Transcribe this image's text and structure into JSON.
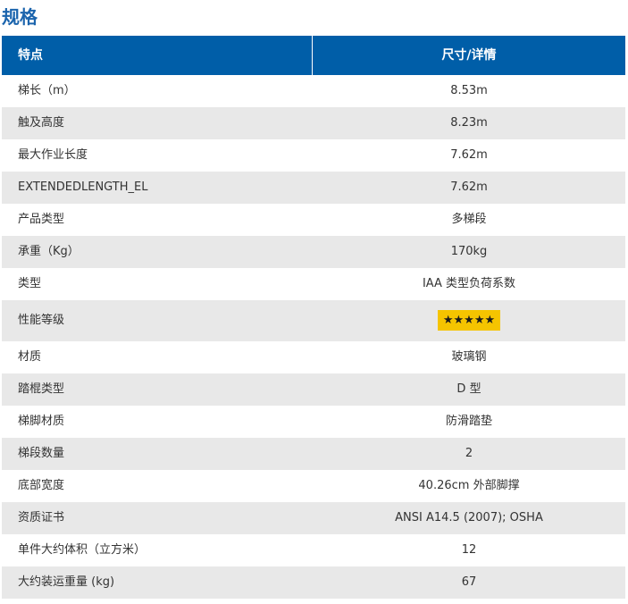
{
  "page": {
    "title": "规格"
  },
  "table": {
    "header": {
      "feature": "特点",
      "detail": "尺寸/详情"
    },
    "rows": [
      {
        "feature": "梯长（m）",
        "value": "8.53m"
      },
      {
        "feature": "触及高度",
        "value": "8.23m"
      },
      {
        "feature": "最大作业长度",
        "value": "7.62m"
      },
      {
        "feature": "EXTENDEDLENGTH_EL",
        "value": "7.62m"
      },
      {
        "feature": "产品类型",
        "value": "多梯段"
      },
      {
        "feature": "承重（Kg）",
        "value": "170kg"
      },
      {
        "feature": "类型",
        "value": "IAA 类型负荷系数"
      },
      {
        "feature": "性能等级",
        "value": "★★★★★",
        "rating": 5
      },
      {
        "feature": "材质",
        "value": "玻璃钢"
      },
      {
        "feature": "踏棍类型",
        "value": "D 型"
      },
      {
        "feature": "梯脚材质",
        "value": "防滑踏垫"
      },
      {
        "feature": "梯段数量",
        "value": "2"
      },
      {
        "feature": "底部宽度",
        "value": "40.26cm 外部脚撑"
      },
      {
        "feature": "资质证书",
        "value": "ANSI A14.5 (2007); OSHA"
      },
      {
        "feature": "单件大约体积（立方米）",
        "value": "12"
      },
      {
        "feature": "大约装运重量 (kg)",
        "value": "67"
      }
    ]
  },
  "colors": {
    "title": "#1b64ad",
    "header_background": "#005ea8",
    "alt_row_background": "#e8e8e8",
    "rating_badge": "#f5c400"
  }
}
